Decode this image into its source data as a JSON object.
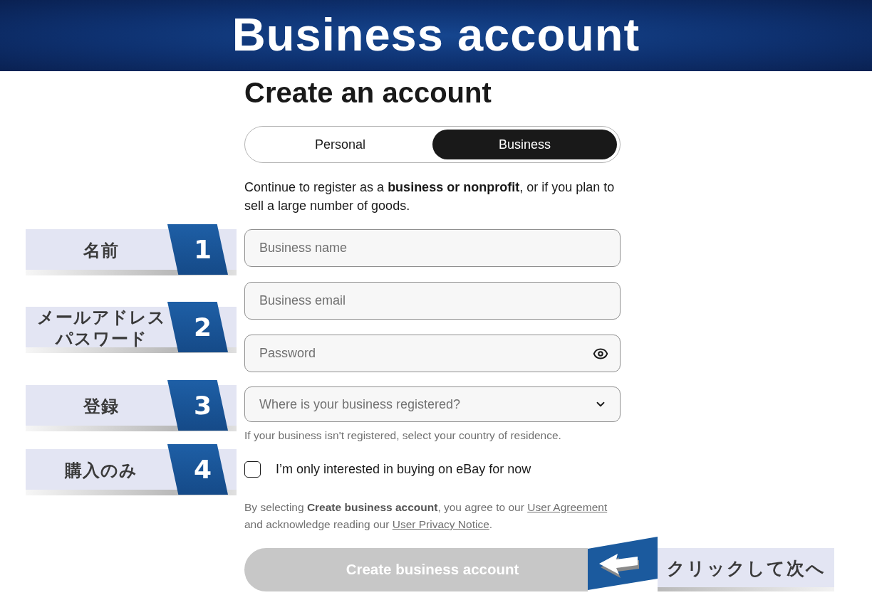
{
  "header": {
    "title": "Business account"
  },
  "annotations": [
    {
      "number": "1",
      "lines": [
        "名前"
      ]
    },
    {
      "number": "2",
      "lines": [
        "メールアドレス",
        "パスワード"
      ]
    },
    {
      "number": "3",
      "lines": [
        "登録"
      ]
    },
    {
      "number": "4",
      "lines": [
        "購入のみ"
      ]
    }
  ],
  "form": {
    "heading": "Create an account",
    "account_type_tabs": [
      {
        "label": "Personal",
        "selected": false
      },
      {
        "label": "Business",
        "selected": true
      }
    ],
    "intro": "Continue to register as a **business or nonprofit**, or if you plan to sell a large number of goods.",
    "fields": [
      {
        "kind": "text",
        "placeholder": "Business name"
      },
      {
        "kind": "text",
        "placeholder": "Business email"
      },
      {
        "kind": "password",
        "placeholder": "Password"
      },
      {
        "kind": "select",
        "placeholder": "Where is your business registered?"
      }
    ],
    "select_hint": "If your business isn't registered, select your country of residence.",
    "buying_only": {
      "label": "I’m only interested in buying on eBay for now",
      "checked": false
    },
    "legal": [
      {
        "kind": "text",
        "text": "By selecting **Create business account**, you agree to our "
      },
      {
        "kind": "link",
        "text": "User Agreement"
      },
      {
        "kind": "text",
        "text": " and acknowledge reading our "
      },
      {
        "kind": "link",
        "text": "User Privacy Notice"
      },
      {
        "kind": "text",
        "text": "."
      }
    ],
    "submit": {
      "label": "Create business account",
      "disabled": true
    }
  },
  "next_step_callout": {
    "label": "クリックして次へ"
  }
}
